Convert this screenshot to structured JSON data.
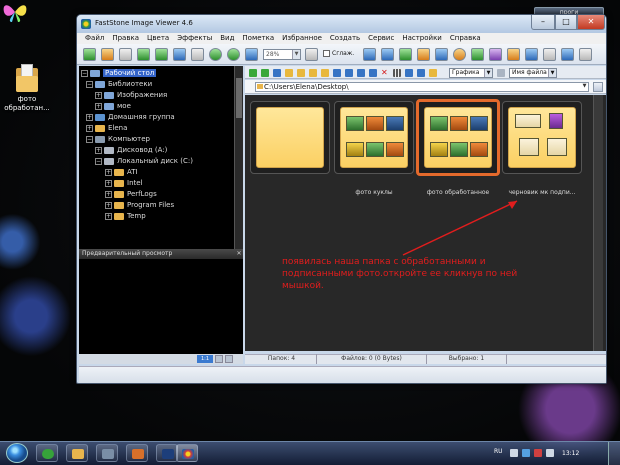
{
  "window": {
    "title": "FastStone Image Viewer 4.6"
  },
  "titlebar": {
    "minimize": "–",
    "maximize": "□",
    "close": "✕"
  },
  "desktop": {
    "icon_label_1": "фото",
    "icon_label_2": "обработан...",
    "prog_button": "проги"
  },
  "menu": [
    "Файл",
    "Правка",
    "Цвета",
    "Эффекты",
    "Вид",
    "Пометка",
    "Избранное",
    "Создать",
    "Сервис",
    "Настройки",
    "Справка"
  ],
  "toolbar": {
    "zoom_value": "28%",
    "fit_label": "Сглаж."
  },
  "tree": {
    "items": [
      {
        "label": "Рабочий стол"
      },
      {
        "label": "Библиотеки"
      },
      {
        "label": "Изображения"
      },
      {
        "label": "мое"
      },
      {
        "label": "Домашняя группа"
      },
      {
        "label": "Elena"
      },
      {
        "label": "Компьютер"
      },
      {
        "label": "Дисковод (A:)"
      },
      {
        "label": "Локальный диск (C:)"
      },
      {
        "label": "ATI"
      },
      {
        "label": "Intel"
      },
      {
        "label": "PerfLogs"
      },
      {
        "label": "Program Files"
      },
      {
        "label": "Temp"
      }
    ]
  },
  "preview": {
    "header": "Предварительный просмотр",
    "zoom": "1:1"
  },
  "nav": {
    "view_mode": "Графика",
    "sort_by": "Имя файла"
  },
  "path": {
    "value": "C:\\Users\\Elena\\Desktop\\"
  },
  "thumbnails": [
    {
      "caption": ""
    },
    {
      "caption": "фото куклы"
    },
    {
      "caption": "фото обработанное"
    },
    {
      "caption": "черновик мк подпи..."
    }
  ],
  "status": {
    "folders": "Папок: 4",
    "files": "Файлов: 0 (0 Bytes)",
    "selected": "Выбрано: 1"
  },
  "annotation": {
    "text": "появилась наша папка с обработанными и подписанными фото.откройте ее кликнув по ней мышкой."
  },
  "taskbar": {
    "lang": "RU",
    "time": "13:12"
  },
  "colors": {
    "annotation": "#e11d1d",
    "selection_border": "#e46a2c",
    "tree_selection": "#3464c9"
  }
}
